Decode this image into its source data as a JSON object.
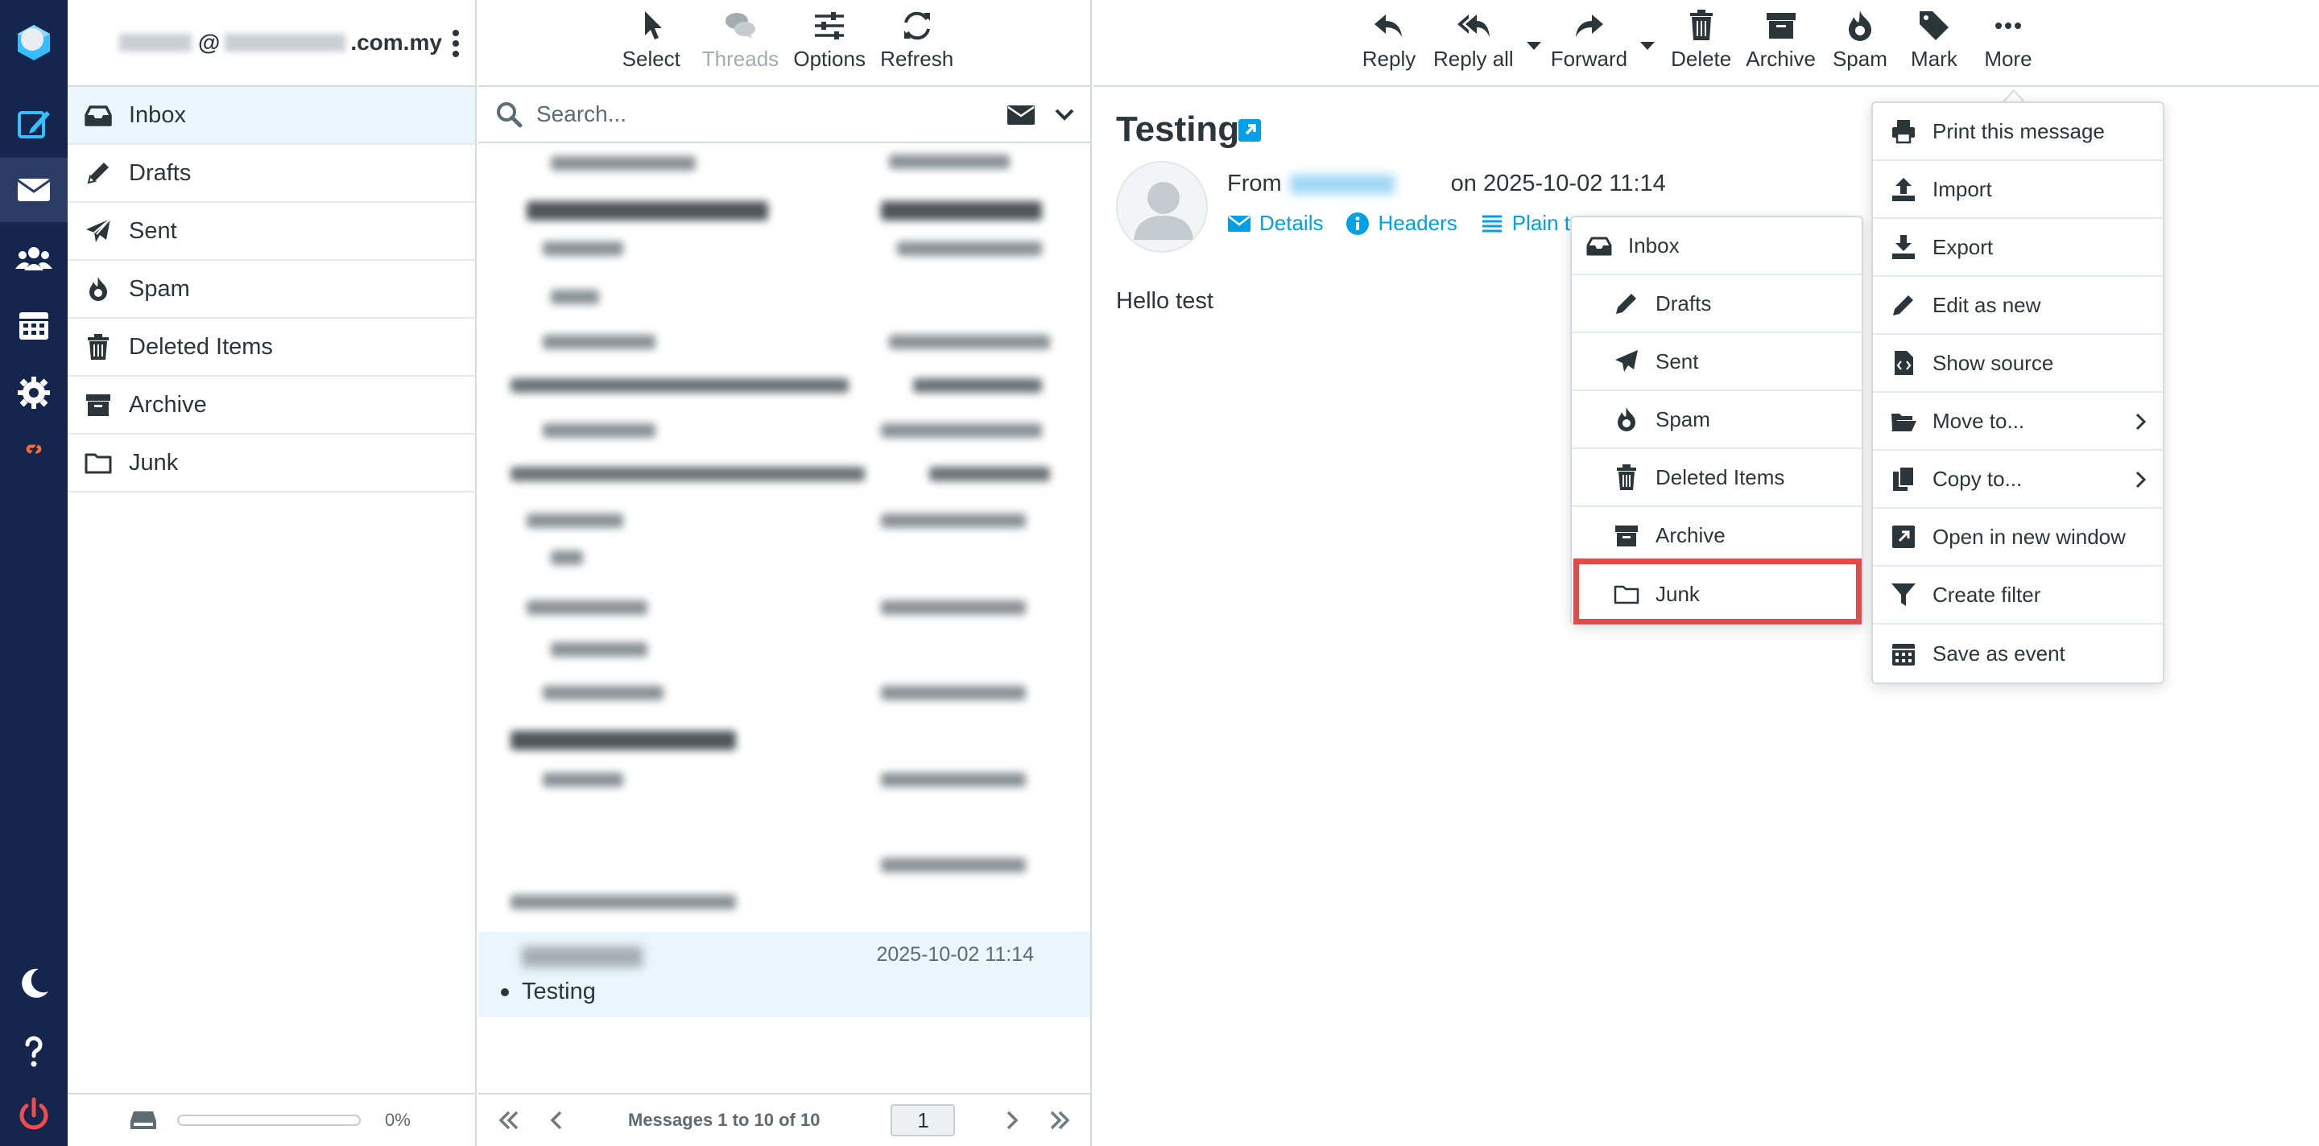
{
  "account": {
    "email_visible": ".com.my"
  },
  "rail": {
    "icons": [
      "logo-icon",
      "compose-icon",
      "mail-icon",
      "contacts-icon",
      "calendar-icon",
      "settings-icon",
      "cpanel-icon",
      "dark-mode-icon",
      "help-icon",
      "logout-icon"
    ]
  },
  "folders": {
    "items": [
      {
        "label": "Inbox",
        "icon": "inbox-icon"
      },
      {
        "label": "Drafts",
        "icon": "pencil-icon"
      },
      {
        "label": "Sent",
        "icon": "paper-plane-icon"
      },
      {
        "label": "Spam",
        "icon": "fire-icon"
      },
      {
        "label": "Deleted Items",
        "icon": "trash-icon"
      },
      {
        "label": "Archive",
        "icon": "archive-icon"
      },
      {
        "label": "Junk",
        "icon": "folder-icon"
      }
    ],
    "quota_percent": 0,
    "quota_text": "0%"
  },
  "list_toolbar": {
    "select": "Select",
    "threads": "Threads",
    "options": "Options",
    "refresh": "Refresh"
  },
  "search": {
    "placeholder": "Search..."
  },
  "selected_message": {
    "date": "2025-10-02 11:14",
    "subject": "Testing"
  },
  "pagination": {
    "text": "Messages 1 to 10 of 10",
    "page": "1"
  },
  "view_toolbar": {
    "reply": "Reply",
    "reply_all": "Reply all",
    "forward": "Forward",
    "delete": "Delete",
    "archive": "Archive",
    "spam": "Spam",
    "mark": "Mark",
    "more": "More"
  },
  "message": {
    "subject": "Testing",
    "from_label": "From",
    "date_text": "on 2025-10-02 11:14",
    "links": {
      "details": "Details",
      "headers": "Headers",
      "plain": "Plain te"
    },
    "body": "Hello test"
  },
  "more_menu": {
    "items": [
      {
        "label": "Print this message",
        "icon": "print-icon"
      },
      {
        "label": "Import",
        "icon": "upload-icon"
      },
      {
        "label": "Export",
        "icon": "download-icon"
      },
      {
        "label": "Edit as new",
        "icon": "pencil-icon"
      },
      {
        "label": "Show source",
        "icon": "code-file-icon"
      },
      {
        "label": "Move to...",
        "icon": "folder-open-icon",
        "submenu": true
      },
      {
        "label": "Copy to...",
        "icon": "copy-icon",
        "submenu": true
      },
      {
        "label": "Open in new window",
        "icon": "external-window-icon"
      },
      {
        "label": "Create filter",
        "icon": "filter-icon"
      },
      {
        "label": "Save as event",
        "icon": "calendar-icon"
      }
    ]
  },
  "move_menu": {
    "items": [
      {
        "label": "Inbox",
        "icon": "inbox-icon"
      },
      {
        "label": "Drafts",
        "icon": "pencil-icon"
      },
      {
        "label": "Sent",
        "icon": "paper-plane-icon"
      },
      {
        "label": "Spam",
        "icon": "fire-icon"
      },
      {
        "label": "Deleted Items",
        "icon": "trash-icon"
      },
      {
        "label": "Archive",
        "icon": "archive-icon"
      },
      {
        "label": "Junk",
        "icon": "folder-icon"
      }
    ]
  },
  "colors": {
    "rail": "#14264d",
    "accent": "#00a0e6",
    "selected": "#eaf6fc",
    "highlight": "#e34a4a"
  }
}
